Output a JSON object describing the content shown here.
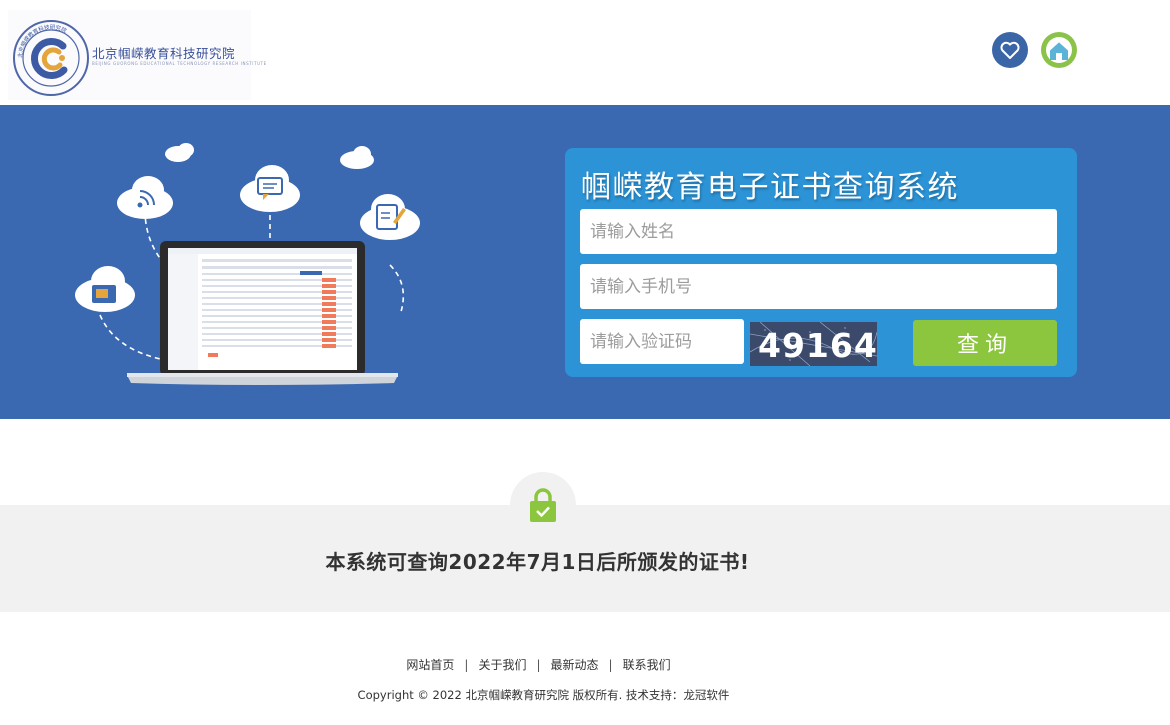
{
  "header": {
    "logo_cn": "北京帼嵘教育科技研究院",
    "logo_en": "BEIJING GUORONG EDUCATIONAL TECHNOLOGY RESEARCH INSTITUTE",
    "logo_ring_text": "北京帼嵘教育科技研究院",
    "icons": [
      "heart-icon",
      "home-icon"
    ],
    "colors": {
      "heart_button": "#3a66a8",
      "home_button": "#8bc34a"
    }
  },
  "banner": {
    "background": "#3a69b1",
    "title": "帼嵘教育电子证书查询系统",
    "name_placeholder": "请输入姓名",
    "phone_placeholder": "请输入手机号",
    "code_placeholder": "请输入验证码",
    "captcha": "49164",
    "query_button": "查询"
  },
  "notice": {
    "text": "本系统可查询2022年7月1日后所颁发的证书!",
    "icon": "lock-check-icon"
  },
  "footer": {
    "links": [
      "网站首页",
      "关于我们",
      "最新动态",
      "联系我们"
    ],
    "separator": "|",
    "copyright": "Copyright © 2022 北京帼嵘教育研究院 版权所有. 技术支持：龙冠软件"
  }
}
